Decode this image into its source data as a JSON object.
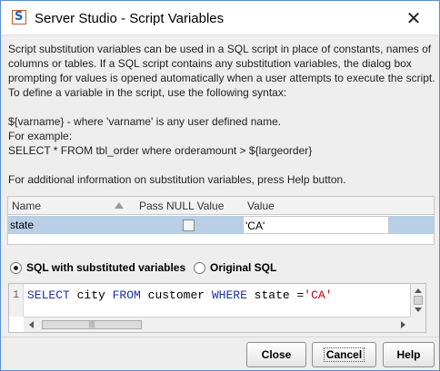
{
  "window": {
    "title": "Server Studio - Script Variables",
    "icon": "server-studio-app-icon",
    "close_glyph": "✕"
  },
  "description": {
    "paragraph": "Script substitution variables can be used in a SQL script in place of constants, names of columns or tables. If a SQL script contains any substitution variables, the dialog box prompting for values is opened automatically when a user attempts to execute the script. To define a variable in the script, use the following syntax:",
    "syntax": "${varname} - where 'varname' is any user defined name.",
    "example_label": "For example:",
    "example": "SELECT * FROM tbl_order where orderamount  > ${largeorder}",
    "help_note": "For additional information on substitution variables, press Help button."
  },
  "table": {
    "columns": [
      "Name",
      "Pass NULL Value",
      "Value"
    ],
    "rows": [
      {
        "name": "state",
        "pass_null": false,
        "value": "'CA'"
      }
    ]
  },
  "mode": {
    "options": [
      "SQL with substituted variables",
      "Original SQL"
    ],
    "selected": "SQL with substituted variables"
  },
  "editor": {
    "line_number": "1",
    "tokens": [
      {
        "text": "SELECT",
        "type": "keyword"
      },
      {
        "text": " city ",
        "type": "plain"
      },
      {
        "text": "FROM",
        "type": "keyword"
      },
      {
        "text": " customer ",
        "type": "plain"
      },
      {
        "text": "WHERE",
        "type": "keyword"
      },
      {
        "text": " state =",
        "type": "plain"
      },
      {
        "text": "'CA'",
        "type": "string"
      }
    ],
    "hscroll_grip": "|||"
  },
  "buttons": {
    "close": "Close",
    "cancel": "Cancel",
    "help": "Help"
  },
  "colors": {
    "selected_row": "#b8cfe5",
    "keyword": "#1c2fa8",
    "string": "#c0001a",
    "window_border": "#5a8fd0"
  }
}
